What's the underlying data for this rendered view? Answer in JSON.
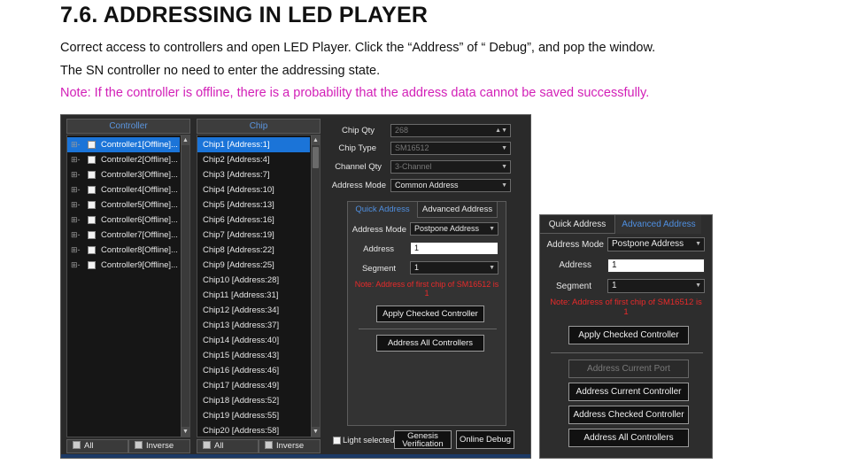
{
  "doc": {
    "title": "7.6. ADDRESSING IN LED PLAYER",
    "p1": "Correct access to controllers and open LED Player. Click the “Address” of “ Debug”, and pop the window.",
    "p2": "The SN controller no need to enter the addressing state.",
    "note": "Note: If the controller is offline, there is a probability that the address data cannot be saved successfully."
  },
  "controller_panel": {
    "header": "Controller",
    "items": [
      "Controller1[Offline]...",
      "Controller2[Offline]...",
      "Controller3[Offline]...",
      "Controller4[Offline]...",
      "Controller5[Offline]...",
      "Controller6[Offline]...",
      "Controller7[Offline]...",
      "Controller8[Offline]...",
      "Controller9[Offline]..."
    ],
    "all_label": "All",
    "inverse_label": "Inverse"
  },
  "chip_panel": {
    "header": "Chip",
    "items": [
      "Chip1 [Address:1]",
      "Chip2 [Address:4]",
      "Chip3 [Address:7]",
      "Chip4 [Address:10]",
      "Chip5 [Address:13]",
      "Chip6 [Address:16]",
      "Chip7 [Address:19]",
      "Chip8 [Address:22]",
      "Chip9 [Address:25]",
      "Chip10 [Address:28]",
      "Chip11 [Address:31]",
      "Chip12 [Address:34]",
      "Chip13 [Address:37]",
      "Chip14 [Address:40]",
      "Chip15 [Address:43]",
      "Chip16 [Address:46]",
      "Chip17 [Address:49]",
      "Chip18 [Address:52]",
      "Chip19 [Address:55]",
      "Chip20 [Address:58]"
    ],
    "all_label": "All",
    "inverse_label": "Inverse"
  },
  "settings": {
    "chip_qty_label": "Chip Qty",
    "chip_qty_value": "268",
    "chip_type_label": "Chip Type",
    "chip_type_value": "SM16512",
    "channel_qty_label": "Channel Qty",
    "channel_qty_value": "3-Channel",
    "address_mode_label": "Address Mode",
    "address_mode_value": "Common Address"
  },
  "quick_dialog": {
    "tab_quick": "Quick Address",
    "tab_advanced": "Advanced Address",
    "address_mode_label": "Address Mode",
    "address_mode_value": "Postpone Address",
    "address_label": "Address",
    "address_value": "1",
    "segment_label": "Segment",
    "segment_value": "1",
    "note_line1": "Note: Address of first chip of SM16512 is",
    "note_line2": "1",
    "apply_checked": "Apply Checked Controller",
    "address_all": "Address All Controllers"
  },
  "bottom_bar": {
    "light_selected": "Light selected c",
    "genesis_line1": "Genesis",
    "genesis_line2": "Verification",
    "online_debug": "Online Debug"
  },
  "advanced_dialog": {
    "tab_quick": "Quick Address",
    "tab_advanced": "Advanced Address",
    "address_mode_label": "Address Mode",
    "address_mode_value": "Postpone Address",
    "address_label": "Address",
    "address_value": "1",
    "segment_label": "Segment",
    "segment_value": "1",
    "note_line1": "Note: Address of first chip of SM16512 is",
    "note_line2": "1",
    "apply_checked": "Apply Checked Controller",
    "address_current_port": "Address Current Port",
    "address_current_controller": "Address Current Controller",
    "address_checked_controller": "Address Checked Controller",
    "address_all": "Address All Controllers"
  },
  "colors": {
    "note_text": "#d21fb7",
    "selection_blue": "#1b74d8",
    "warning_red": "#e82a2a",
    "tab_active": "#4f8fe0"
  }
}
